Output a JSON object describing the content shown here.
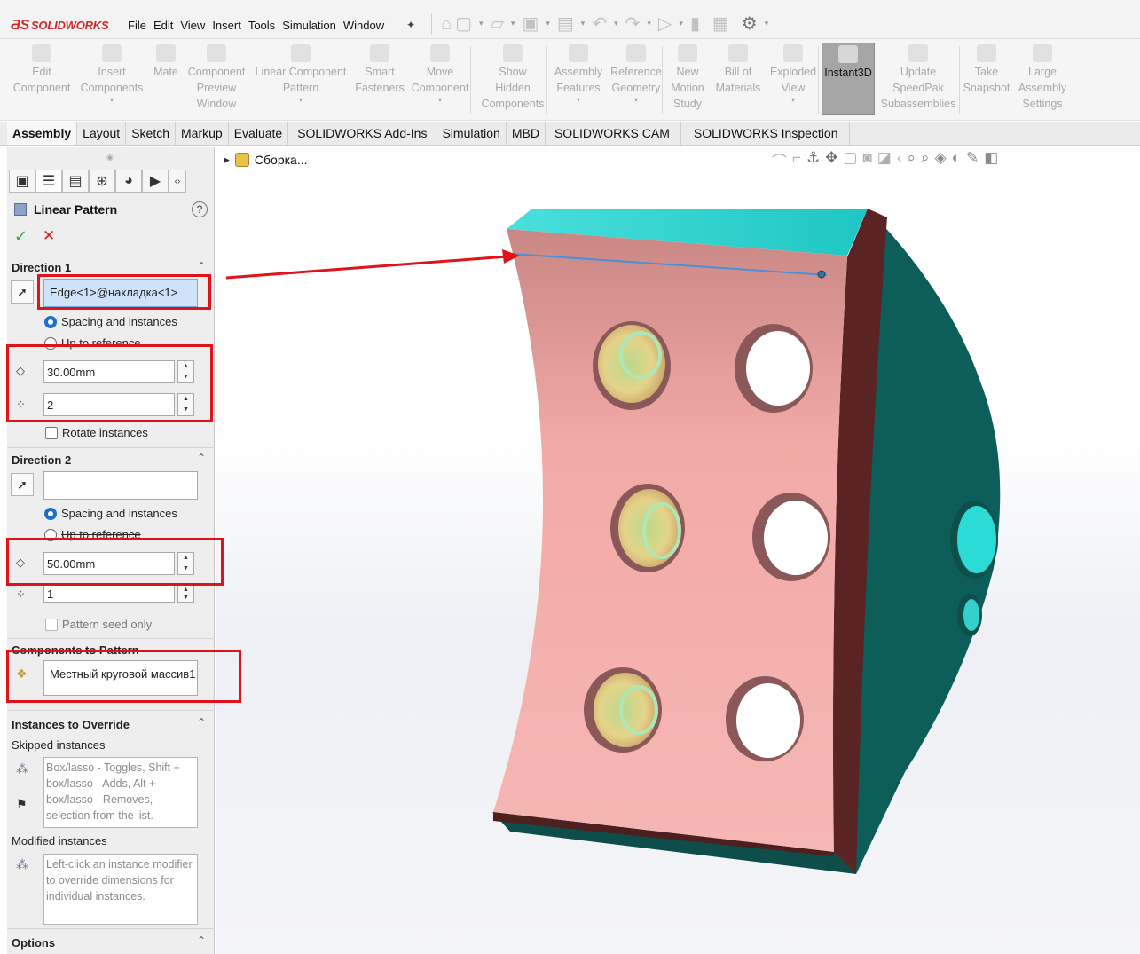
{
  "app": {
    "logo": "SOLIDWORKS",
    "menus": [
      "File",
      "Edit",
      "View",
      "Insert",
      "Tools",
      "Simulation",
      "Window"
    ]
  },
  "commands": [
    {
      "label": "Edit\nComponent",
      "dd": false
    },
    {
      "label": "Insert\nComponents",
      "dd": true
    },
    {
      "label": "Mate",
      "dd": false
    },
    {
      "label": "Component\nPreview\nWindow",
      "dd": false
    },
    {
      "label": "Linear Component\nPattern",
      "dd": true
    },
    {
      "label": "Smart\nFasteners",
      "dd": false
    },
    {
      "label": "Move\nComponent",
      "dd": true
    },
    {
      "label": "Show\nHidden\nComponents",
      "dd": false
    },
    {
      "label": "Assembly\nFeatures",
      "dd": true
    },
    {
      "label": "Reference\nGeometry",
      "dd": true
    },
    {
      "label": "New\nMotion\nStudy",
      "dd": false
    },
    {
      "label": "Bill of\nMaterials",
      "dd": false
    },
    {
      "label": "Exploded\nView",
      "dd": true
    },
    {
      "label": "Instant3D",
      "dd": false
    },
    {
      "label": "Update\nSpeedPak\nSubassemblies",
      "dd": false
    },
    {
      "label": "Take\nSnapshot",
      "dd": false
    },
    {
      "label": "Large\nAssembly\nSettings",
      "dd": false
    }
  ],
  "tabs": [
    "Assembly",
    "Layout",
    "Sketch",
    "Markup",
    "Evaluate",
    "SOLIDWORKS Add-Ins",
    "Simulation",
    "MBD",
    "SOLIDWORKS CAM",
    "SOLIDWORKS Inspection"
  ],
  "tree": {
    "label": "Сборка..."
  },
  "pm": {
    "title": "Linear Pattern",
    "help": "?",
    "ok": "✓",
    "cancel": "✕",
    "dir1": {
      "heading": "Direction 1",
      "edge": "Edge<1>@накладка<1>",
      "opt_spacing": "Spacing and instances",
      "opt_ref": "Up to reference",
      "spacing": "30.00mm",
      "instances": "2",
      "rotate": "Rotate instances"
    },
    "dir2": {
      "heading": "Direction 2",
      "edge": "",
      "opt_spacing": "Spacing and instances",
      "opt_ref": "Up to reference",
      "spacing": "50.00mm",
      "instances": "1",
      "seed": "Pattern seed only"
    },
    "comp": {
      "heading": "Components to Pattern",
      "value": "Местный круговой массив1"
    },
    "override": {
      "heading": "Instances to Override",
      "skipped_label": "Skipped instances",
      "skipped_hint": "Box/lasso - Toggles, Shift + box/lasso - Adds, Alt + box/lasso - Removes, selection from the list.",
      "modified_label": "Modified instances",
      "modified_hint": "Left-click an instance modifier to override dimensions for individual instances."
    },
    "options": {
      "heading": "Options"
    }
  },
  "colors": {
    "highlight": "#e0121a",
    "face_pink": "#f2a7a4",
    "side_teal": "#0c5a56",
    "top_cyan": "#2fd6d2",
    "hole_edge": "#7ad8a0"
  }
}
